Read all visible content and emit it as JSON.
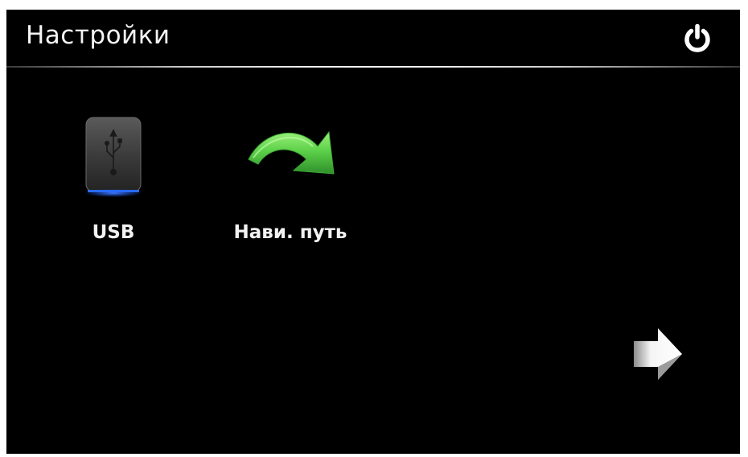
{
  "header": {
    "title": "Настройки",
    "power_icon": "power-icon"
  },
  "tiles": [
    {
      "label": "USB",
      "icon": "usb-drive-icon"
    },
    {
      "label": "Нави. путь",
      "icon": "green-curved-arrow-icon"
    }
  ],
  "navigation": {
    "next_icon": "next-page-arrow-icon"
  },
  "colors": {
    "background": "#000000",
    "text": "#f2f2f2",
    "usb_glow": "#1e5cff",
    "arrow_green": "#5dd14a"
  }
}
